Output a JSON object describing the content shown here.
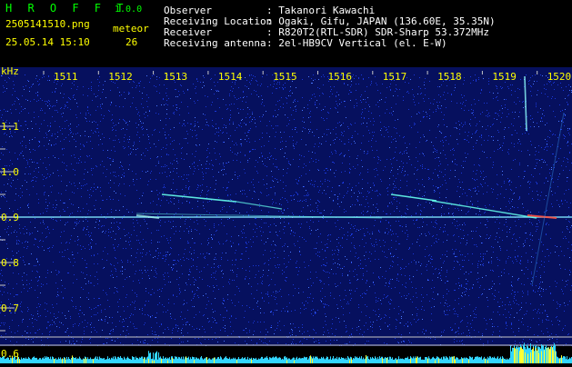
{
  "header": {
    "app_title": "H R O F F T",
    "version": "1.0.0",
    "file_name": "2505141510.png",
    "meteor_label": "meteor",
    "meteor_count": "26",
    "datetime": "25.05.14 15:10",
    "fields": [
      {
        "label": "Observer",
        "value": ": Takanori Kawachi"
      },
      {
        "label": "Receiving Location",
        "value": ": Ogaki, Gifu, JAPAN (136.60E, 35.35N)"
      },
      {
        "label": "Receiver",
        "value": ": R820T2(RTL-SDR) SDR-Sharp 53.372MHz"
      },
      {
        "label": "Receiving antenna",
        "value": ": 2el-HB9CV Vertical (el. E-W)"
      }
    ]
  },
  "axis": {
    "unit": "kHz",
    "x_ticks": [
      "1511",
      "1512",
      "1513",
      "1514",
      "1515",
      "1516",
      "1517",
      "1518",
      "1519",
      "1520"
    ],
    "y_ticks": [
      "1.1",
      "1.0",
      "0.9",
      "0.8",
      "0.7",
      "0.6"
    ]
  },
  "colors": {
    "background": "#000000",
    "label_yellow": "#ffff00",
    "title_green": "#00ff00",
    "noise_blue": "#0b1a8a",
    "signal_cyan": "#66ffee"
  }
}
